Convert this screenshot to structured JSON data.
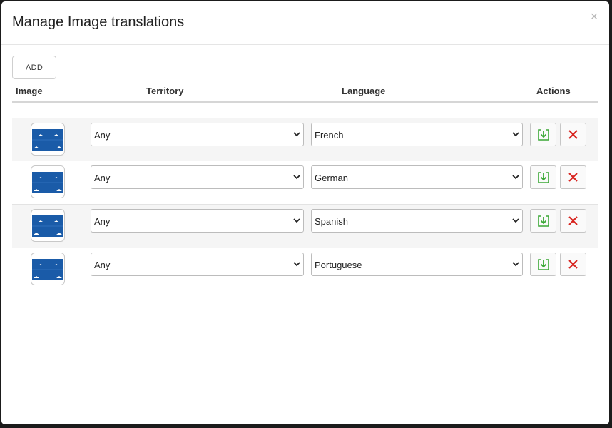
{
  "dialog": {
    "title": "Manage Image translations",
    "close_label": "×"
  },
  "toolbar": {
    "add_label": "ADD"
  },
  "table": {
    "columns": [
      "Image",
      "Territory",
      "Language",
      "Actions"
    ],
    "rows": [
      {
        "territory": "Any",
        "language": "French"
      },
      {
        "territory": "Any",
        "language": "German"
      },
      {
        "territory": "Any",
        "language": "Spanish"
      },
      {
        "territory": "Any",
        "language": "Portuguese"
      }
    ]
  },
  "colors": {
    "save_icon": "#3aa835",
    "delete_icon": "#d8241f",
    "thumbnail_blue": "#1a5ba8"
  },
  "icons": {
    "save": "save-icon",
    "delete": "delete-icon",
    "image": "image-thumbnail-icon",
    "dropdown": "chevron-down-icon",
    "close": "close-icon"
  }
}
